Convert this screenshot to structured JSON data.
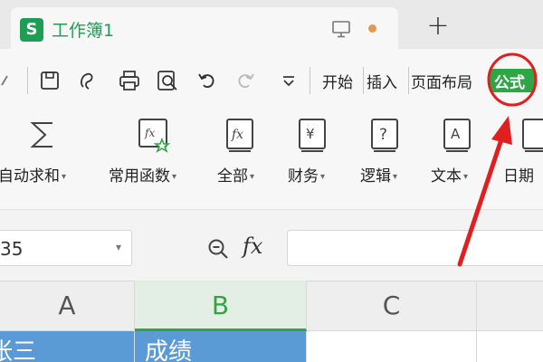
{
  "window": {
    "doc_logo": "S",
    "doc_title": "工作簿1",
    "new_tab": "+"
  },
  "menu": {
    "tabs": [
      "开始",
      "插入",
      "页面布局",
      "公式"
    ],
    "active_tab": "公式",
    "accent": "#2fa646"
  },
  "ribbon": {
    "items": [
      {
        "label": "自动求和",
        "icon": "sigma-icon"
      },
      {
        "label": "常用函数",
        "icon": "fx-star-icon"
      },
      {
        "label": "全部",
        "icon": "fx-book-icon"
      },
      {
        "label": "财务",
        "icon": "yen-book-icon"
      },
      {
        "label": "逻辑",
        "icon": "question-book-icon"
      },
      {
        "label": "文本",
        "icon": "text-book-icon"
      },
      {
        "label": "日期",
        "icon": "calendar-book-icon"
      }
    ]
  },
  "formula_bar": {
    "name_box": "35",
    "fx_label": "fx"
  },
  "grid": {
    "columns": [
      "A",
      "B",
      "C"
    ],
    "selected_column": "B",
    "row1": [
      "张三",
      "成绩"
    ]
  }
}
